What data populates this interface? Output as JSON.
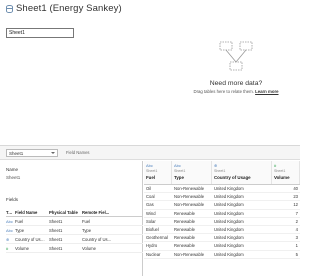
{
  "window": {
    "title": "Sheet1 (Energy Sankey)"
  },
  "canvas": {
    "sheet_chip": "Sheet1",
    "empty_state": {
      "title": "Need more data?",
      "subtitle": "Drag tables here to relate them.",
      "link": "Learn more"
    }
  },
  "toolbar": {
    "sheet_select": "Sheet1",
    "field_names_label": "Field Names"
  },
  "details": {
    "name_label": "Name",
    "name_value": "Sheet1",
    "fields_label": "Fields",
    "columns": [
      "Type",
      "Field Name",
      "Physical Table",
      "Remote Fiel..."
    ],
    "rows": [
      {
        "type_icon": "Abc",
        "type_kind": "string",
        "field": "Fuel",
        "table": "Sheet1",
        "remote": "Fuel"
      },
      {
        "type_icon": "Abc",
        "type_kind": "string",
        "field": "Type",
        "table": "Sheet1",
        "remote": "Type"
      },
      {
        "type_icon": "⊕",
        "type_kind": "geo",
        "field": "Country of Usage",
        "table": "Sheet1",
        "remote": "Country of Us..."
      },
      {
        "type_icon": "#",
        "type_kind": "number",
        "field": "Volume",
        "table": "Sheet1",
        "remote": "Volume"
      }
    ]
  },
  "data_grid": {
    "columns": [
      {
        "icon": "Abc",
        "kind": "string",
        "source": "Sheet1",
        "name": "Fuel"
      },
      {
        "icon": "Abc",
        "kind": "string",
        "source": "Sheet1",
        "name": "Type"
      },
      {
        "icon": "⊕",
        "kind": "geo",
        "source": "Sheet1",
        "name": "Country of Usage"
      },
      {
        "icon": "#",
        "kind": "number",
        "source": "Sheet1",
        "name": "Volume"
      }
    ],
    "rows": [
      [
        "Oil",
        "Non-Renewable",
        "United Kingdom",
        "40"
      ],
      [
        "Coal",
        "Non-Renewable",
        "United Kingdom",
        "23"
      ],
      [
        "Gas",
        "Non-Renewable",
        "United Kingdom",
        "12"
      ],
      [
        "Wind",
        "Renewable",
        "United Kingdom",
        "7"
      ],
      [
        "Solar",
        "Renewable",
        "United Kingdom",
        "2"
      ],
      [
        "Biofuel",
        "Renewable",
        "United Kingdom",
        "4"
      ],
      [
        "Geothermal",
        "Renewable",
        "United Kingdom",
        "3"
      ],
      [
        "Hydro",
        "Renewable",
        "United Kingdom",
        "1"
      ],
      [
        "Nuclear",
        "Non-Renewable",
        "United Kingdom",
        "5"
      ]
    ]
  },
  "colors": {
    "string_type": "#4f81bd",
    "number_type": "#2aa24a"
  }
}
